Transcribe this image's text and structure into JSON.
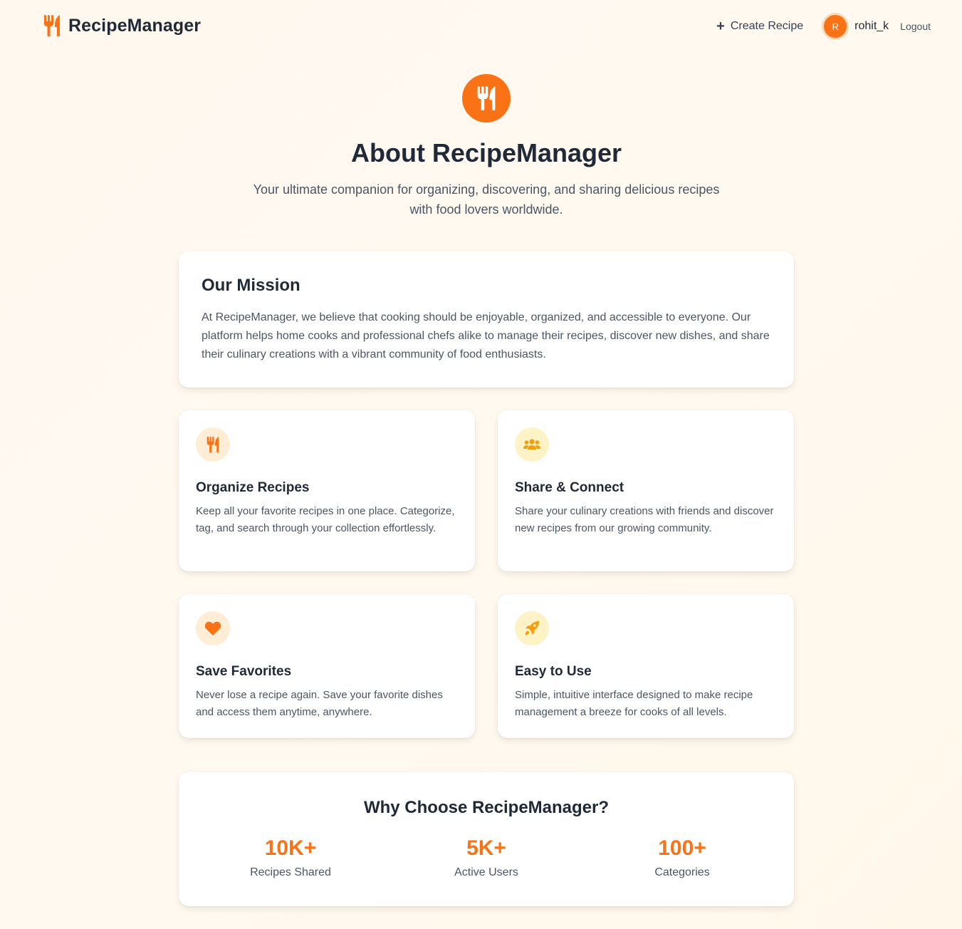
{
  "header": {
    "brand": "RecipeManager",
    "create_label": "Create Recipe",
    "avatar_initial": "R",
    "username": "rohit_k",
    "logout_label": "Logout"
  },
  "hero": {
    "title": "About RecipeManager",
    "subtitle": "Your ultimate companion for organizing, discovering, and sharing delicious recipes with food lovers worldwide."
  },
  "mission": {
    "title": "Our Mission",
    "body": "At RecipeManager, we believe that cooking should be enjoyable, organized, and accessible to everyone. Our platform helps home cooks and professional chefs alike to manage their recipes, discover new dishes, and share their culinary creations with a vibrant community of food enthusiasts."
  },
  "features": [
    {
      "icon": "utensils-icon",
      "title": "Organize Recipes",
      "body": "Keep all your favorite recipes in one place. Categorize, tag, and search through your collection effortlessly."
    },
    {
      "icon": "users-icon",
      "title": "Share & Connect",
      "body": "Share your culinary creations with friends and discover new recipes from our growing community."
    },
    {
      "icon": "heart-icon",
      "title": "Save Favorites",
      "body": "Never lose a recipe again. Save your favorite dishes and access them anytime, anywhere."
    },
    {
      "icon": "rocket-icon",
      "title": "Easy to Use",
      "body": "Simple, intuitive interface designed to make recipe management a breeze for cooks of all levels."
    }
  ],
  "why": {
    "title": "Why Choose RecipeManager?",
    "stats": [
      {
        "value": "10K+",
        "label": "Recipes Shared"
      },
      {
        "value": "5K+",
        "label": "Active Users"
      },
      {
        "value": "100+",
        "label": "Categories"
      }
    ]
  },
  "colors": {
    "accent": "#f97316",
    "accent_light": "#ffedd5",
    "yellow_light": "#fef3c7",
    "text_dark": "#1f2937",
    "text_muted": "#4b5563"
  }
}
